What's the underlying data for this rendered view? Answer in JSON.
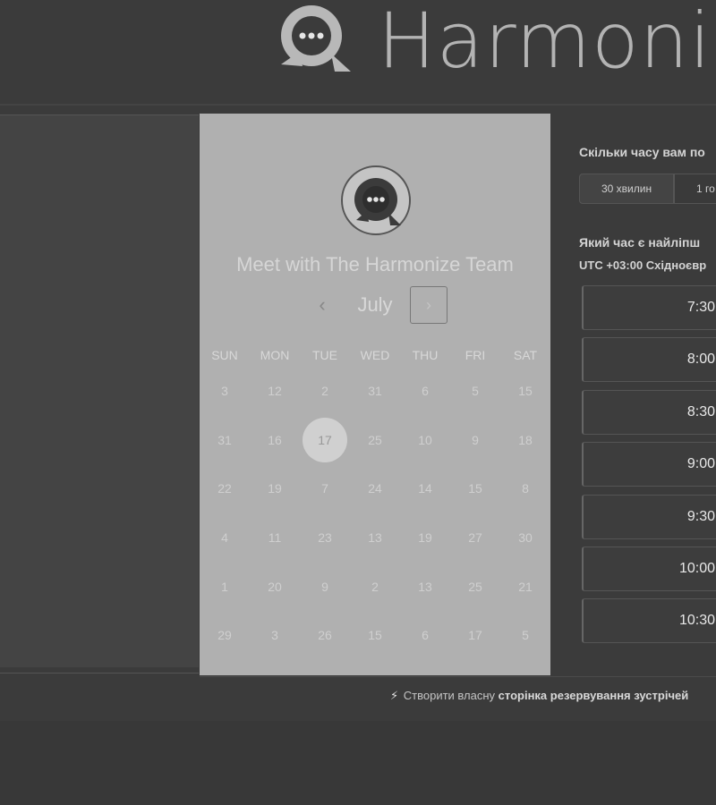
{
  "header": {
    "logo_text": "Harmoni"
  },
  "calendar": {
    "title": "Meet with The Harmonize Team",
    "month": "July",
    "prev_glyph": "‹",
    "next_glyph": "›",
    "weekdays": [
      "SUN",
      "MON",
      "TUE",
      "WED",
      "THU",
      "FRI",
      "SAT"
    ],
    "days": [
      [
        "3",
        "12",
        "2",
        "31",
        "6",
        "5",
        "15"
      ],
      [
        "31",
        "16",
        "17",
        "25",
        "10",
        "9",
        "18"
      ],
      [
        "22",
        "19",
        "7",
        "24",
        "14",
        "15",
        "8"
      ],
      [
        "4",
        "11",
        "23",
        "13",
        "19",
        "27",
        "30"
      ],
      [
        "1",
        "20",
        "9",
        "2",
        "13",
        "25",
        "21"
      ],
      [
        "29",
        "3",
        "26",
        "15",
        "6",
        "17",
        "5"
      ]
    ],
    "selected_day": "17"
  },
  "times": {
    "duration_question": "Скільки часу вам по",
    "durations": [
      "30 хвилин",
      "1 го"
    ],
    "time_question": "Який час є найліпш",
    "timezone": "UTC +03:00 Східноєвр",
    "slots": [
      "7:30",
      "8:00",
      "8:30",
      "9:00",
      "9:30",
      "10:00",
      "10:30"
    ]
  },
  "footer": {
    "link_prefix": "Створити власну",
    "link_bold": "сторінка резервування зустрічей"
  },
  "colors": {
    "page_bg": "#3b3b3b",
    "card_bg": "#b0b0b0",
    "text_light": "#d6d6d6"
  }
}
